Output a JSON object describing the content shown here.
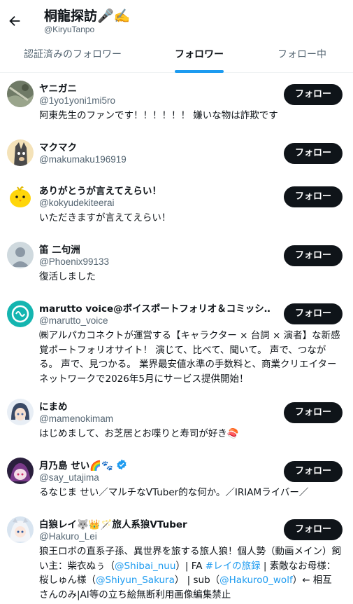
{
  "header": {
    "title": "桐龍探訪🎤✍️",
    "handle": "@KiryuTanpo"
  },
  "tabs": [
    {
      "label": "認証済みのフォロワー"
    },
    {
      "label": "フォロワー"
    },
    {
      "label": "フォロー中"
    }
  ],
  "follow_label": "フォロー",
  "users": [
    {
      "name": "ヤニガニ",
      "handle": "@1yo1yoni1mi5ro",
      "bio": "阿東先生のファンです！！！！！！ 嫌いな物は詐欺です"
    },
    {
      "name": "マクマク",
      "handle": "@makumaku196919",
      "bio": ""
    },
    {
      "name": "ありがとうが言えてえらい！",
      "handle": "@kokyudekiteerai",
      "bio": "いただきますが言えてえらい！"
    },
    {
      "name": "笛 二句洲",
      "handle": "@Phoenix99133",
      "bio": "復活しました"
    },
    {
      "name": "marutto voice@ボイスポートフォリオ＆コミッシ…",
      "handle": "@marutto_voice",
      "bio": "㈱アルパカコネクトが運営する【キャラクター × 台詞 × 演者】な新感覚ポートフォリオサイト！ 演じて、比べて、聞いて。 声で、つながる。 声で、見つかる。 業界最安値水準の手数料と、商業クリエイターネットワークで2026年5月にサービス提供開始！"
    },
    {
      "name": "にまめ",
      "handle": "@mamenokimam",
      "bio": "はじめまして、お芝居とお喋りと寿司が好き🍣"
    },
    {
      "name": "月乃島 せい🌈🐾",
      "handle": "@say_utajima",
      "bio": "るなじま せい／マルチなVTuber的な何か。／IRIAMライバー／"
    },
    {
      "name": "白狼レイ🐺👑🪄旅人系狼VTuber",
      "handle": "@Hakuro_Lei",
      "bio_parts": [
        "狼王ロボの直系子孫、異世界を旅する旅人狼！個人勢（動画メイン）飼い主：柴衣ぬぅ（",
        "@Shibai_nuu",
        "）| FA ",
        "#レイの旅録",
        " | 素敵なお母様：桜しゅん様（",
        "@Shiyun_Sakura",
        "） | sub（",
        "@Hakuro0_wolf",
        "）← 相互さんのみ|AI等の立ち絵無断利用画像編集禁止"
      ]
    }
  ],
  "colors": {
    "accent": "#1d9bf0",
    "button": "#0f1419",
    "muted": "#536471"
  }
}
